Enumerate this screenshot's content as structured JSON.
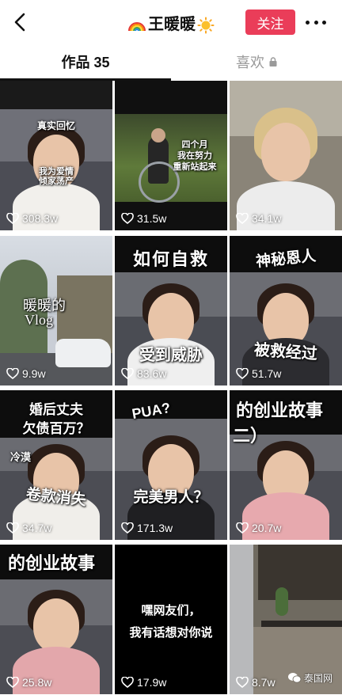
{
  "header": {
    "title": "王暖暖",
    "follow_label": "关注",
    "accent_color": "#ea3d59"
  },
  "tabs": [
    {
      "label": "作品 35",
      "active": true
    },
    {
      "label": "喜欢",
      "active": false
    }
  ],
  "videos": [
    {
      "likes": "308.3w",
      "captions": [
        "真实回忆",
        "我为爱情",
        "倾家荡产"
      ]
    },
    {
      "likes": "31.5w",
      "captions": [
        "四个月",
        "我在努力",
        "重新站起来"
      ]
    },
    {
      "likes": "34.1w",
      "captions": []
    },
    {
      "likes": "9.9w",
      "captions": [
        "暖暖的",
        "Vlog"
      ]
    },
    {
      "likes": "83.6w",
      "captions": [
        "如何自救",
        "受到威胁"
      ]
    },
    {
      "likes": "51.7w",
      "captions": [
        "神秘恩人",
        "被救经过"
      ]
    },
    {
      "likes": "34.7w",
      "captions": [
        "婚后丈夫",
        "欠债百万？",
        "冷漠",
        "卷款消失"
      ]
    },
    {
      "likes": "171.3w",
      "captions": [
        "PUA?",
        "完美男人？"
      ]
    },
    {
      "likes": "20.7w",
      "captions": [
        "的创业故事",
        "二）"
      ]
    },
    {
      "likes": "25.8w",
      "captions": [
        "的创业故事"
      ]
    },
    {
      "likes": "17.9w",
      "captions": [
        "嘿网友们，",
        "我有话想对你说"
      ]
    },
    {
      "likes": "8.7w",
      "captions": []
    }
  ],
  "watermark": "泰国网"
}
